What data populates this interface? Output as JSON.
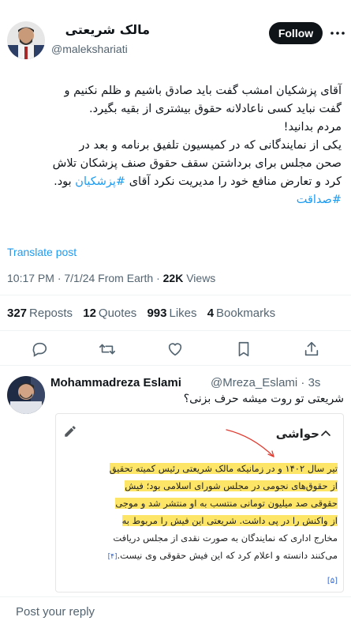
{
  "tweet": {
    "author_name": "مالک شریعتی",
    "author_handle": "@malekshariati",
    "follow_label": "Follow",
    "lines": [
      "آقای پزشکیان امشب گفت باید صادق باشیم و ظلم نکنیم و",
      "گفت نباید کسی ناعادلانه حقوق بیشتری از بقیه بگیرد.",
      "مردم بدانید!",
      "یکی از نمایندگانی که در کمیسیون تلفیق برنامه و بعد در",
      "صحن مجلس برای برداشتن سقف حقوق صنف پزشکان تلاش",
      "کرد و تعارض منافع خود را مدیریت نکرد آقای",
      "#پزشکیان",
      "بود.",
      "#صداقت"
    ],
    "translate_label": "Translate post",
    "time": "10:17 PM · 7/1/24 From Earth · ",
    "views_count": "22K",
    "views_label": " Views",
    "stats": {
      "reposts_count": "327",
      "reposts_label": "Reposts",
      "quotes_count": "12",
      "quotes_label": "Quotes",
      "likes_count": "993",
      "likes_label": "Likes",
      "bookmarks_count": "4",
      "bookmarks_label": "Bookmarks"
    }
  },
  "reply": {
    "name": "Mohammadreza Eslami",
    "handle_time": "@Mreza_Eslami · 3s",
    "text": "شریعتی تو روت میشه حرف بزنی؟",
    "card": {
      "heading": "حواشی",
      "lines": [
        "تیر سال ۱۴۰۲ و در زمانیکه مالک شریعتی رئیس کمیته تحقیق",
        "از حقوق‌های نجومی در مجلس شورای اسلامی بود؛ فیش",
        "حقوقی صد میلیون تومانی منتسب به او منتشر شد و موجی",
        "از واکنش را در پی داشت. شریعتی این فیش را مربوط به",
        "مخارج اداری که نمایندگان به صورت نقدی از مجلس دریافت",
        "می‌کنند دانسته و اعلام کرد که این فیش حقوقی وی نیست."
      ],
      "footnote_inline": "[۴]",
      "footnote_below": "[۵]"
    }
  },
  "composer": {
    "placeholder": "Post your reply"
  },
  "icons": {
    "more": "more-dots-icon",
    "reply": "reply-bubble-icon",
    "repost": "repost-icon",
    "like": "heart-icon",
    "bookmark": "bookmark-icon",
    "share": "share-icon",
    "edit": "pencil-icon",
    "collapse": "chevron-up-icon"
  },
  "colors": {
    "accent": "#1d9bf0",
    "highlight": "#fde567",
    "text": "#0f1419",
    "muted": "#536471"
  }
}
